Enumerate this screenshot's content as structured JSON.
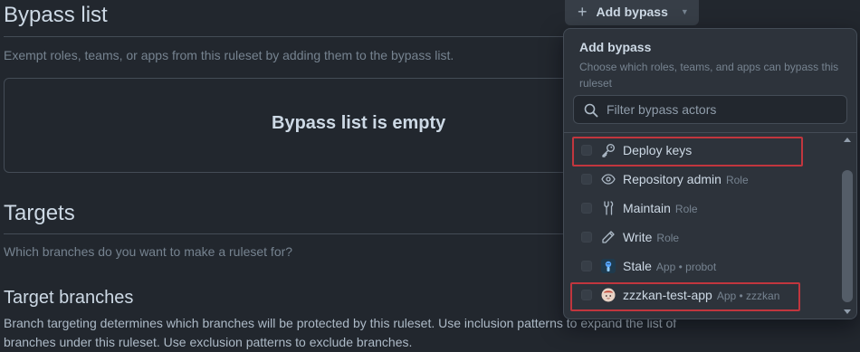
{
  "bypass": {
    "heading": "Bypass list",
    "description": "Exempt roles, teams, or apps from this ruleset by adding them to the bypass list.",
    "empty_title": "Bypass list is empty",
    "add_button_label": "Add bypass"
  },
  "targets": {
    "heading": "Targets",
    "question": "Which branches do you want to make a ruleset for?",
    "branches_heading": "Target branches",
    "branches_line1": "Branch targeting determines which branches will be protected by this ruleset. Use inclusion patterns to expand the list of",
    "branches_line2": "branches under this ruleset. Use exclusion patterns to exclude branches."
  },
  "dropdown": {
    "title": "Add bypass",
    "description": "Choose which roles, teams, and apps can bypass this ruleset",
    "filter_placeholder": "Filter bypass actors",
    "items": [
      {
        "label": "Deploy keys",
        "meta": "",
        "icon": "key-icon",
        "highlighted": true
      },
      {
        "label": "Repository admin",
        "meta": "Role",
        "icon": "eye-icon",
        "highlighted": false
      },
      {
        "label": "Maintain",
        "meta": "Role",
        "icon": "tools-icon",
        "highlighted": false
      },
      {
        "label": "Write",
        "meta": "Role",
        "icon": "pencil-icon",
        "highlighted": false
      },
      {
        "label": "Stale",
        "meta": "App • probot",
        "icon": "stale-app-avatar-icon",
        "highlighted": false
      },
      {
        "label": "zzzkan-test-app",
        "meta": "App • zzzkan",
        "icon": "app-avatar-icon",
        "highlighted": true
      }
    ]
  },
  "colors": {
    "background": "#22272e",
    "panel": "#2d333b",
    "highlight_border": "#c1363e"
  }
}
